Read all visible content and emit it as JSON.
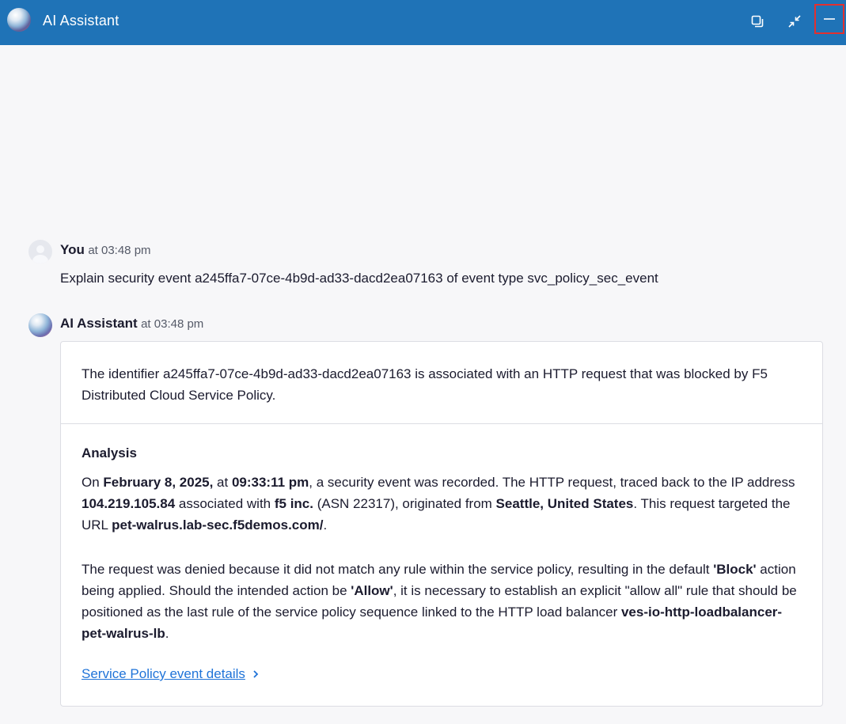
{
  "header": {
    "title": "AI Assistant",
    "icons": [
      "logo-orb-icon",
      "popout-icon",
      "collapse-icon",
      "minimize-icon"
    ],
    "highlight_color": "#e3302f",
    "bar_color": "#1f73b7"
  },
  "conversation": {
    "user_message": {
      "author": "You",
      "time": "at 03:48 pm",
      "text": "Explain security event a245ffa7-07ce-4b9d-ad33-dacd2ea07163 of event type svc_policy_sec_event"
    },
    "assistant_message": {
      "author": "AI Assistant",
      "time": "at 03:48 pm",
      "intro": "The identifier a245ffa7-07ce-4b9d-ad33-dacd2ea07163 is associated with an HTTP request that was blocked by F5 Distributed Cloud Service Policy.",
      "analysis_heading": "Analysis",
      "p1": {
        "t1": "On ",
        "date": "February 8, 2025,",
        "t2": " at ",
        "clock": "09:33:11 pm",
        "t3": ", a security event was recorded. The HTTP request, traced back to the IP address ",
        "ip": "104.219.105.84",
        "t4": " associated with ",
        "org": "f5 inc.",
        "t5": " (ASN 22317), originated from ",
        "location": "Seattle, United States",
        "t6": ". This request targeted the URL ",
        "url": "pet-walrus.lab-sec.f5demos.com/",
        "t7": "."
      },
      "p2": {
        "t1": "The request was denied because it did not match any rule within the service policy, resulting in the default ",
        "block": "'Block'",
        "t2": " action being applied. Should the intended action be ",
        "allow": "'Allow'",
        "t3": ", it is necessary to establish an explicit \"allow all\" rule that should be positioned as the last rule of the service policy sequence linked to the HTTP load balancer ",
        "lb": "ves-io-http-loadbalancer-pet-walrus-lb",
        "t4": "."
      },
      "link_label": "Service Policy event details"
    }
  }
}
